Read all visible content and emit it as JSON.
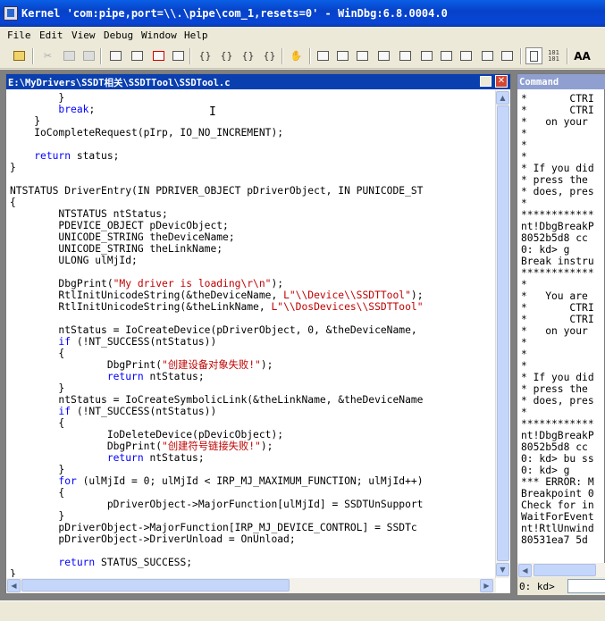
{
  "window": {
    "title": "Kernel 'com:pipe,port=\\\\.\\pipe\\com_1,resets=0' - WinDbg:6.8.0004.0"
  },
  "menu": [
    "File",
    "Edit",
    "View",
    "Debug",
    "Window",
    "Help"
  ],
  "toolbar": {
    "icons": [
      "open-icon",
      "cut-icon",
      "copy-icon",
      "paste-icon",
      "insert-breakpoint-icon",
      "break-icon",
      "stop-debugging-icon",
      "restart-icon",
      "step-into-icon",
      "step-over-icon",
      "step-out-icon",
      "run-to-cursor-icon",
      "hand-icon",
      "command-window-icon",
      "watch-window-icon",
      "locals-window-icon",
      "registers-window-icon",
      "memory-window-icon",
      "call-stack-icon",
      "disassembly-icon",
      "scratch-pad-icon",
      "source-mode-icon",
      "hex-mode-icon",
      "font-icon"
    ],
    "hex_label": "101\n101",
    "font_label": "AA"
  },
  "source": {
    "path": "E:\\MyDrivers\\SSDT相关\\SSDTTool\\SSDTool.c",
    "lines": [
      [
        [
          "        }",
          ""
        ]
      ],
      [
        [
          "        ",
          ""
        ],
        [
          "break",
          ""
        ],
        [
          ";",
          ""
        ]
      ],
      [
        [
          "    }",
          ""
        ]
      ],
      [
        [
          "    IoCompleteRequest(pIrp, IO_NO_INCREMENT);",
          ""
        ]
      ],
      [
        [
          "",
          ""
        ]
      ],
      [
        [
          "    ",
          ""
        ],
        [
          "return",
          ""
        ],
        [
          " status;",
          ""
        ]
      ],
      [
        [
          "}",
          ""
        ]
      ],
      [
        [
          "",
          ""
        ]
      ],
      [
        [
          "NTSTATUS DriverEntry(IN PDRIVER_OBJECT pDriverObject, IN PUNICODE_ST",
          ""
        ]
      ],
      [
        [
          "{",
          ""
        ]
      ],
      [
        [
          "        NTSTATUS ntStatus;",
          ""
        ]
      ],
      [
        [
          "        PDEVICE_OBJECT pDevicObject;",
          ""
        ]
      ],
      [
        [
          "        UNICODE_STRING theDeviceName;",
          ""
        ]
      ],
      [
        [
          "        UNICODE_STRING theLinkName;",
          ""
        ]
      ],
      [
        [
          "        ULONG ulMjId;",
          ""
        ]
      ],
      [
        [
          "",
          ""
        ]
      ],
      [
        [
          "        DbgPrint(",
          ""
        ],
        [
          "\"My driver is loading\\r\\n\"",
          ""
        ],
        [
          ");",
          ""
        ]
      ],
      [
        [
          "        RtlInitUnicodeString(&theDeviceName, ",
          ""
        ],
        [
          "L\"\\\\Device\\\\SSDTTool\"",
          ""
        ],
        [
          ");",
          ""
        ]
      ],
      [
        [
          "        RtlInitUnicodeString(&theLinkName, ",
          ""
        ],
        [
          "L\"\\\\DosDevices\\\\SSDTTool\"",
          ""
        ]
      ],
      [
        [
          "",
          ""
        ]
      ],
      [
        [
          "        ntStatus = IoCreateDevice(pDriverObject, 0, &theDeviceName,",
          ""
        ]
      ],
      [
        [
          "        ",
          ""
        ],
        [
          "if",
          ""
        ],
        [
          " (!NT_SUCCESS(ntStatus))",
          ""
        ]
      ],
      [
        [
          "        {",
          ""
        ]
      ],
      [
        [
          "                DbgPrint(",
          ""
        ],
        [
          "\"创建设备对象失败!\"",
          ""
        ],
        [
          ");",
          ""
        ]
      ],
      [
        [
          "                ",
          ""
        ],
        [
          "return",
          ""
        ],
        [
          " ntStatus;",
          ""
        ]
      ],
      [
        [
          "        }",
          ""
        ]
      ],
      [
        [
          "        ntStatus = IoCreateSymbolicLink(&theLinkName, &theDeviceName",
          ""
        ]
      ],
      [
        [
          "        ",
          ""
        ],
        [
          "if",
          ""
        ],
        [
          " (!NT_SUCCESS(ntStatus))",
          ""
        ]
      ],
      [
        [
          "        {",
          ""
        ]
      ],
      [
        [
          "                IoDeleteDevice(pDevicObject);",
          ""
        ]
      ],
      [
        [
          "                DbgPrint(",
          ""
        ],
        [
          "\"创建符号链接失败!\"",
          ""
        ],
        [
          ");",
          ""
        ]
      ],
      [
        [
          "                ",
          ""
        ],
        [
          "return",
          ""
        ],
        [
          " ntStatus;",
          ""
        ]
      ],
      [
        [
          "        }",
          ""
        ]
      ],
      [
        [
          "        ",
          ""
        ],
        [
          "for",
          ""
        ],
        [
          " (ulMjId = 0; ulMjId < IRP_MJ_MAXIMUM_FUNCTION; ulMjId++)",
          ""
        ]
      ],
      [
        [
          "        {",
          ""
        ]
      ],
      [
        [
          "                pDriverObject->MajorFunction[ulMjId] = SSDTUnSupport",
          ""
        ]
      ],
      [
        [
          "        }",
          ""
        ]
      ],
      [
        [
          "        pDriverObject->MajorFunction[IRP_MJ_DEVICE_CONTROL] = SSDTc",
          ""
        ]
      ],
      [
        [
          "        pDriverObject->DriverUnload = OnUnload;",
          ""
        ]
      ],
      [
        [
          "",
          ""
        ]
      ],
      [
        [
          "        ",
          ""
        ],
        [
          "return",
          ""
        ],
        [
          " STATUS_SUCCESS;",
          ""
        ]
      ],
      [
        [
          "}",
          ""
        ]
      ]
    ]
  },
  "command": {
    "header": "Command",
    "lines": [
      "*       CTRI",
      "*       CTRI",
      "*   on your",
      "*",
      "*",
      "*",
      "* If you did",
      "* press the",
      "* does, pres",
      "*",
      "************",
      "nt!DbgBreakP",
      "8052b5d8 cc",
      "0: kd> g",
      "Break instru",
      "************",
      "*",
      "*   You are",
      "*       CTRI",
      "*       CTRI",
      "*   on your",
      "*",
      "*",
      "*",
      "* If you did",
      "* press the",
      "* does, pres",
      "*",
      "************",
      "nt!DbgBreakP",
      "8052b5d8 cc",
      "0: kd> bu ss",
      "0: kd> g",
      "*** ERROR: M",
      "Breakpoint 0",
      "Check for in",
      "WaitForEvent",
      "nt!RtlUnwind",
      "80531ea7 5d"
    ],
    "prompt": "0: kd>",
    "input_value": ""
  }
}
